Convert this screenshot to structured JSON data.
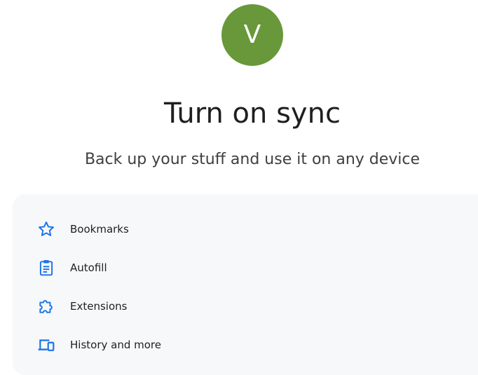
{
  "profile": {
    "avatar_letter": "V",
    "avatar_color": "#68983a"
  },
  "heading": {
    "title": "Turn on sync",
    "subtitle": "Back up your stuff and use it on any device"
  },
  "features": [
    {
      "label": "Bookmarks",
      "icon": "star-icon"
    },
    {
      "label": "Autofill",
      "icon": "clipboard-icon"
    },
    {
      "label": "Extensions",
      "icon": "puzzle-icon"
    },
    {
      "label": "History and more",
      "icon": "devices-icon"
    }
  ],
  "colors": {
    "accent": "#1a73e8",
    "panel_bg": "#f7f8fa"
  }
}
